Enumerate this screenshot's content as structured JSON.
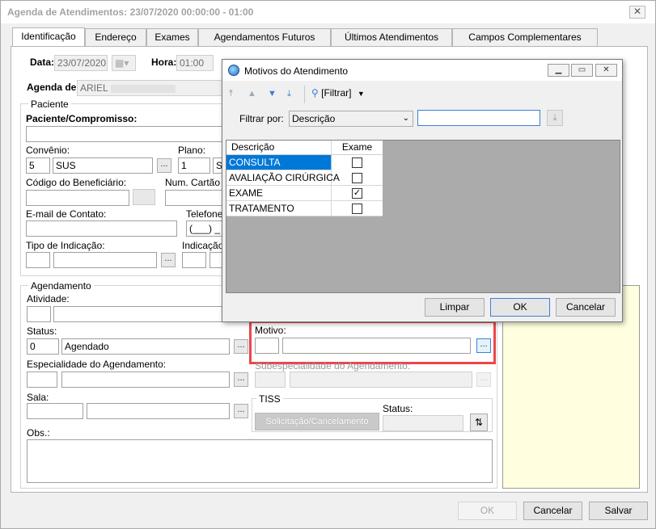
{
  "window": {
    "title": "Agenda de Atendimentos: 23/07/2020 00:00:00 - 01:00",
    "close_label": "✕"
  },
  "tabs": [
    {
      "label": "Identificação"
    },
    {
      "label": "Endereço"
    },
    {
      "label": "Exames"
    },
    {
      "label": "Agendamentos Futuros"
    },
    {
      "label": "Últimos Atendimentos"
    },
    {
      "label": "Campos Complementares"
    }
  ],
  "header": {
    "data_label": "Data:",
    "data_value": "23/07/2020",
    "hora_label": "Hora:",
    "hora_value": "01:00",
    "agenda_label": "Agenda de:",
    "agenda_value": "ARIEL"
  },
  "paciente": {
    "group_title": "Paciente",
    "compromisso_label": "Paciente/Compromisso:",
    "convenio_label": "Convênio:",
    "convenio_code": "5",
    "convenio_name": "SUS",
    "plano_label": "Plano:",
    "plano_code": "1",
    "plano_name": "S",
    "beneficiario_label": "Código do Beneficiário:",
    "cartao_label": "Num. Cartão S",
    "email_label": "E-mail de Contato:",
    "telefone_label": "Telefone",
    "telefone_value": "(___) _",
    "indicacao_label": "Tipo de Indicação:",
    "indicacao2_label": "Indicação"
  },
  "agendamento": {
    "group_title": "Agendamento",
    "atividade_label": "Atividade:",
    "status_label": "Status:",
    "status_code": "0",
    "status_value": "Agendado",
    "motivo_label": "Motivo:",
    "especialidade_label": "Especialidade do Agendamento:",
    "subespecialidade_label": "Subespecialidade do Agendamento:",
    "sala_label": "Sala:",
    "tiss_title": "TISS",
    "tiss_button": "Solicitação/Cancelamento",
    "tiss_status_label": "Status:",
    "obs_label": "Obs.:",
    "ellipsis": "..."
  },
  "footer": {
    "ok": "OK",
    "cancelar": "Cancelar",
    "salvar": "Salvar"
  },
  "dialog": {
    "title": "Motivos do Atendimento",
    "filtrar_button": "[Filtrar]",
    "filtrar_por_label": "Filtrar por:",
    "filtrar_por_value": "Descrição",
    "search_value": "",
    "columns": [
      "Descrição",
      "Exame"
    ],
    "rows": [
      {
        "descricao": "CONSULTA",
        "exame": false,
        "selected": true
      },
      {
        "descricao": "AVALIAÇÃO CIRÚRGICA",
        "exame": false,
        "selected": false
      },
      {
        "descricao": "EXAME",
        "exame": true,
        "selected": false
      },
      {
        "descricao": "TRATAMENTO",
        "exame": false,
        "selected": false
      }
    ],
    "limpar": "Limpar",
    "ok": "OK",
    "cancelar": "Cancelar"
  }
}
